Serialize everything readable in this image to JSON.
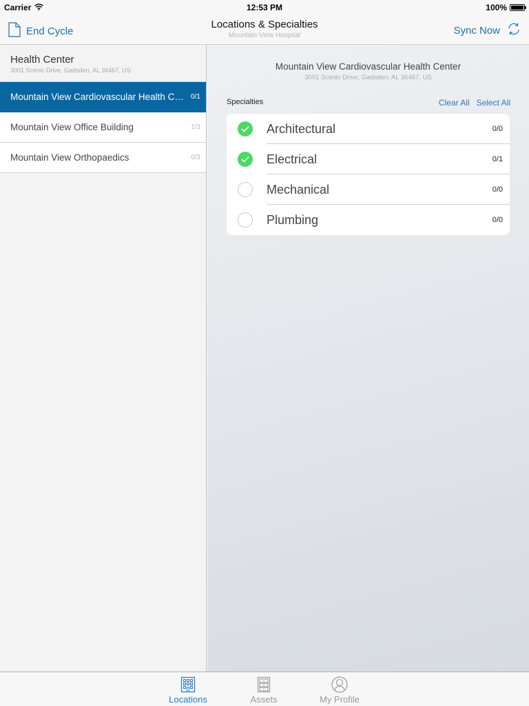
{
  "status_bar": {
    "carrier": "Carrier",
    "time": "12:53 PM",
    "battery": "100%"
  },
  "nav": {
    "left_button": "End Cycle",
    "title": "Locations & Specialties",
    "subtitle": "Mountain View Hospital",
    "right_button": "Sync Now"
  },
  "sidebar": {
    "header": {
      "title": "Health Center",
      "address": "3001 Scenic Drive, Gadsden, AL 36467, US"
    },
    "items": [
      {
        "label": "Mountain View Cardiovascular Health Center",
        "count": "0/1",
        "selected": true
      },
      {
        "label": "Mountain View Office Building",
        "count": "1/3",
        "selected": false
      },
      {
        "label": "Mountain View Orthopaedics",
        "count": "0/3",
        "selected": false
      }
    ]
  },
  "main": {
    "location_title": "Mountain View Cardiovascular Health Center",
    "location_address": "3001 Scenic Drive, Gadsden, AL 36467, US",
    "specialties_label": "Specialties",
    "clear_all": "Clear All",
    "select_all": "Select All",
    "specialties": [
      {
        "name": "Architectural",
        "count": "0/0",
        "checked": true
      },
      {
        "name": "Electrical",
        "count": "0/1",
        "checked": true
      },
      {
        "name": "Mechanical",
        "count": "0/0",
        "checked": false
      },
      {
        "name": "Plumbing",
        "count": "0/0",
        "checked": false
      }
    ]
  },
  "tab_bar": {
    "tabs": [
      {
        "label": "Locations",
        "icon": "building-icon",
        "active": true
      },
      {
        "label": "Assets",
        "icon": "cabinet-icon",
        "active": false
      },
      {
        "label": "My Profile",
        "icon": "profile-icon",
        "active": false
      }
    ]
  },
  "colors": {
    "accent": "#1f6fa8",
    "selected_row": "#0a66a1",
    "check_green": "#4cd964",
    "tab_active": "#1f7ac7"
  }
}
